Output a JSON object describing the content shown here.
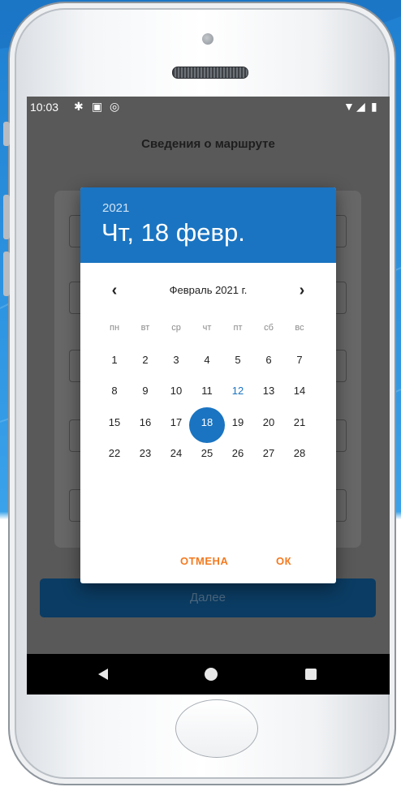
{
  "status": {
    "time": "10:03"
  },
  "app": {
    "title": "Сведения о маршруте",
    "next_button": "Далее"
  },
  "dialog": {
    "year": "2021",
    "selected_date": "Чт, 18 февр.",
    "month_label": "Февраль 2021 г.",
    "prev_icon": "chevron-left-icon",
    "next_icon": "chevron-right-icon",
    "weekdays": [
      "пн",
      "вт",
      "ср",
      "чт",
      "пт",
      "сб",
      "вс"
    ],
    "weeks": [
      [
        "1",
        "2",
        "3",
        "4",
        "5",
        "6",
        "7"
      ],
      [
        "8",
        "9",
        "10",
        "11",
        "12",
        "13",
        "14"
      ],
      [
        "15",
        "16",
        "17",
        "18",
        "19",
        "20",
        "21"
      ],
      [
        "22",
        "23",
        "24",
        "25",
        "26",
        "27",
        "28"
      ]
    ],
    "today": "12",
    "selected": "18",
    "cancel_label": "ОТМЕНА",
    "ok_label": "ОК"
  },
  "colors": {
    "accent": "#1a74c1",
    "action": "#f47a20"
  }
}
